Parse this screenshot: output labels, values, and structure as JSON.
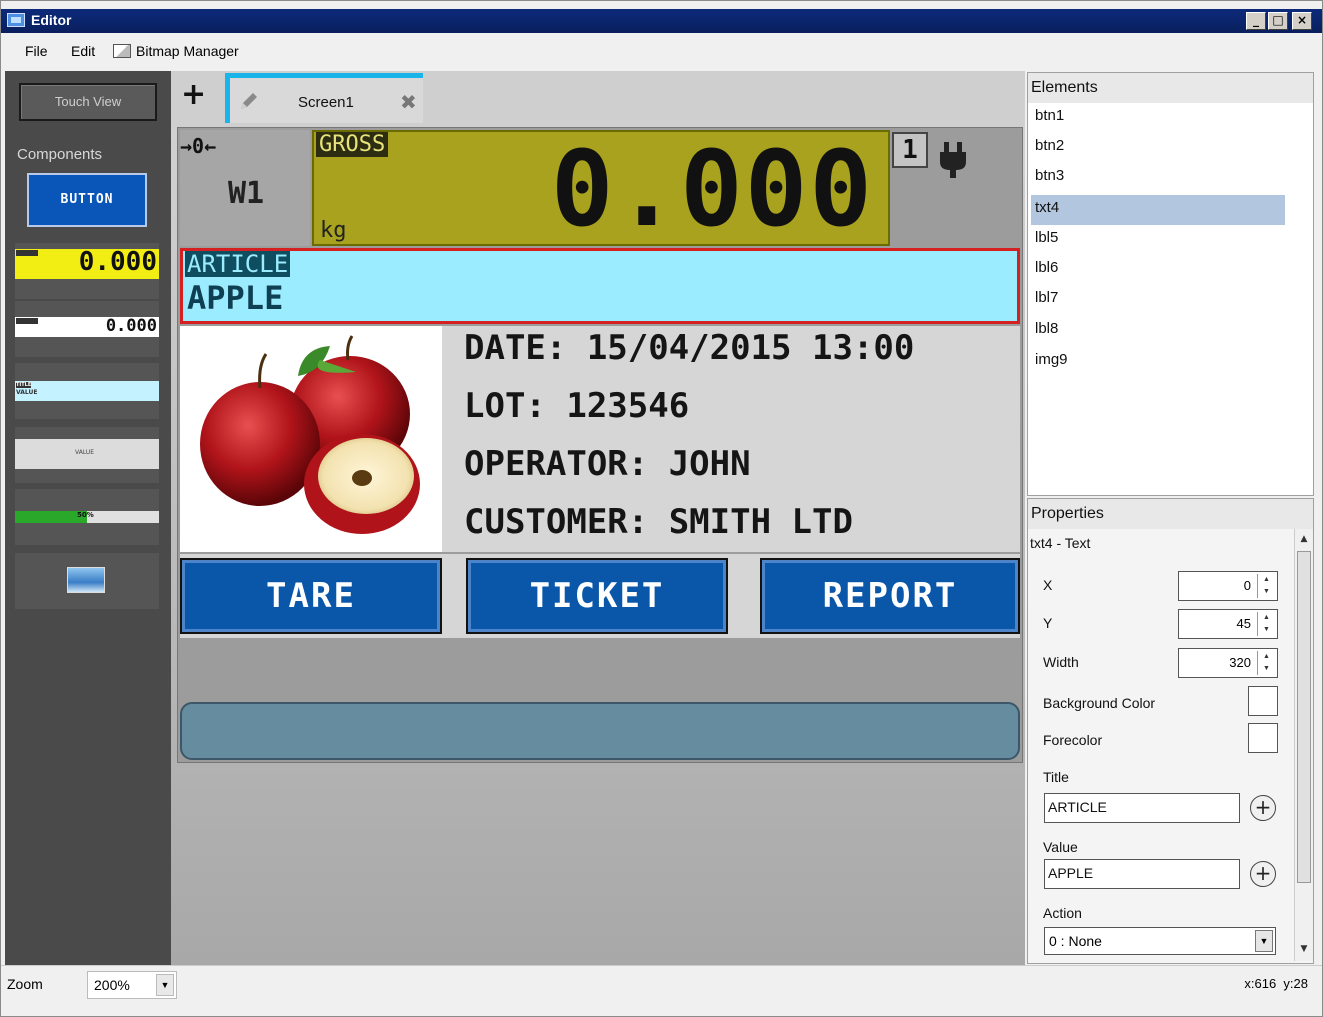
{
  "window": {
    "title": "Editor",
    "controls": [
      "_",
      "□",
      "×"
    ]
  },
  "menu": {
    "file": "File",
    "edit": "Edit",
    "bitmap_manager": "Bitmap Manager"
  },
  "left_panel": {
    "touch_view": "Touch View",
    "components_label": "Components",
    "button_label": "BUTTON",
    "weight_sample": "0.000",
    "weight_sample_2": "0.000",
    "text_title": "TITLE",
    "text_value": "VALUE",
    "label_value": "VALUE",
    "progress_percent": "50%"
  },
  "tabs": [
    {
      "label": "Screen1"
    }
  ],
  "screen": {
    "scale_name": "W1",
    "gross_label": "GROSS",
    "weight": "0.000",
    "unit": "kg",
    "range": "1",
    "article_title": "ARTICLE",
    "article_value": "APPLE",
    "date_line": "DATE: 15/04/2015 13:00",
    "lot_line": "LOT: 123546",
    "operator_line": "OPERATOR: JOHN",
    "customer_line": "CUSTOMER: SMITH LTD",
    "buttons": {
      "tare": "TARE",
      "ticket": "TICKET",
      "report": "REPORT"
    }
  },
  "elements": {
    "header": "Elements",
    "items": [
      "btn1",
      "btn2",
      "btn3",
      "txt4",
      "lbl5",
      "lbl6",
      "lbl7",
      "lbl8",
      "img9"
    ],
    "selected": "txt4"
  },
  "properties": {
    "header": "Properties",
    "subtitle": "txt4 - Text",
    "x_label": "X",
    "x_value": "0",
    "y_label": "Y",
    "y_value": "45",
    "width_label": "Width",
    "width_value": "320",
    "bg_label": "Background Color",
    "fg_label": "Forecolor",
    "title_label": "Title",
    "title_value": "ARTICLE",
    "value_label": "Value",
    "value_value": "APPLE",
    "action_label": "Action",
    "action_value": "0 : None"
  },
  "status": {
    "zoom_label": "Zoom",
    "zoom_value": "200%",
    "coords_x": "x:616",
    "coords_y": "y:28"
  },
  "colors": {
    "accent_tab": "#19b4ea",
    "button_blue": "#0a56a8",
    "weight_bg": "#a8a21e",
    "article_bg": "#9cecff"
  }
}
